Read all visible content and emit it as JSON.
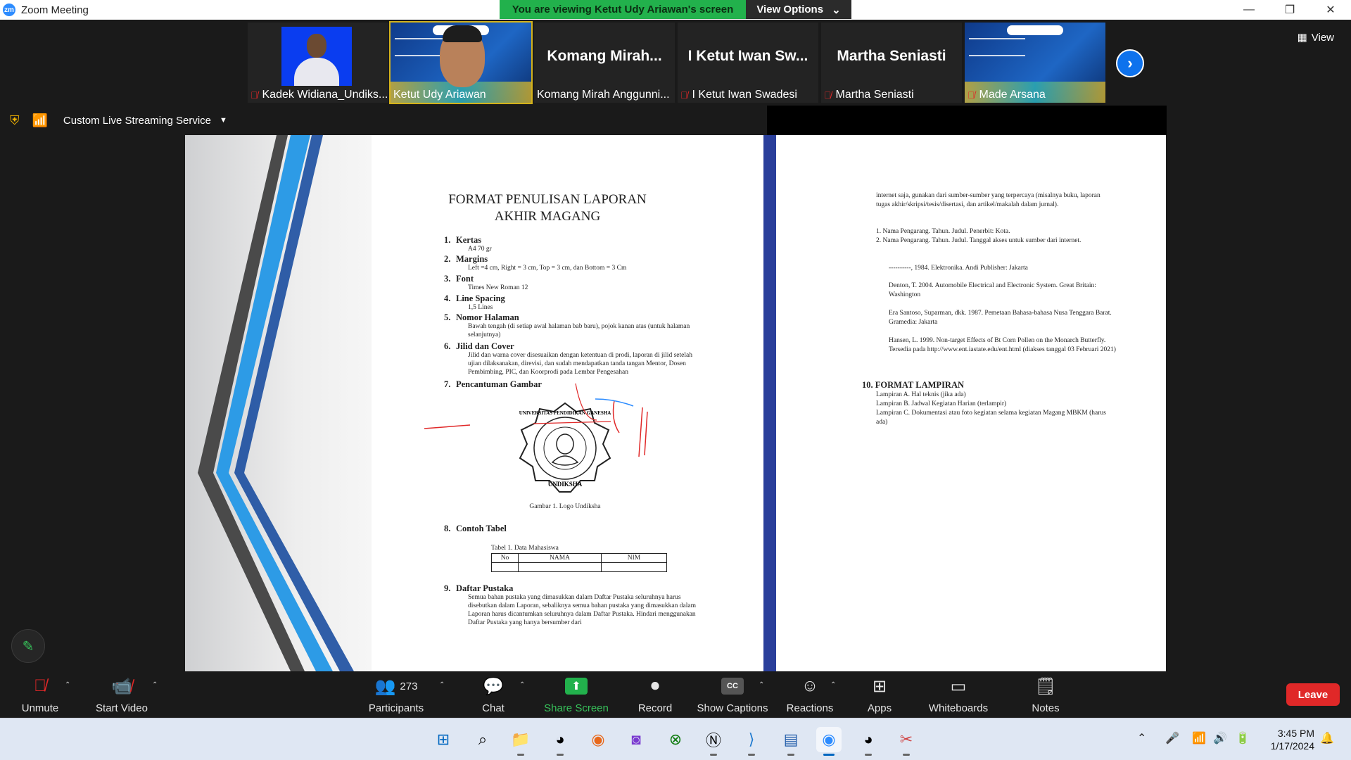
{
  "window": {
    "app_icon_text": "zm",
    "title": "Zoom Meeting",
    "minimize": "—",
    "restore": "❐",
    "close": "✕"
  },
  "banner": {
    "message": "You are viewing Ketut Udy Ariawan's screen",
    "view_options": "View Options",
    "chevron": "⌄"
  },
  "gallery": {
    "view_label": "View",
    "next": "›",
    "tiles": [
      {
        "name": "Kadek Widiana_Undiks...",
        "muted": true,
        "big_name": ""
      },
      {
        "name": "Ketut Udy Ariawan",
        "muted": false,
        "big_name": ""
      },
      {
        "name": "Komang Mirah Anggunni...",
        "muted": false,
        "big_name": "Komang  Mirah..."
      },
      {
        "name": "I Ketut Iwan Swadesi",
        "muted": true,
        "big_name": "I Ketut Iwan Sw..."
      },
      {
        "name": "Martha Seniasti",
        "muted": true,
        "big_name": "Martha Seniasti"
      },
      {
        "name": "Made Arsana",
        "muted": true,
        "big_name": ""
      }
    ]
  },
  "stream": {
    "label": "Custom Live Streaming Service",
    "caret": "▼"
  },
  "document": {
    "title_line1": "FORMAT PENULISAN LAPORAN",
    "title_line2": "AKHIR MAGANG",
    "sections": [
      {
        "num": "1.",
        "title": "Kertas",
        "body": "A4 70 gr"
      },
      {
        "num": "2.",
        "title": "Margins",
        "body": "Left =4 cm, Right = 3 cm, Top = 3 cm, dan Bottom = 3 Cm"
      },
      {
        "num": "3.",
        "title": "Font",
        "body": "Times New Roman 12"
      },
      {
        "num": "4.",
        "title": "Line Spacing",
        "body": "1,5 Lines"
      },
      {
        "num": "5.",
        "title": "Nomor Halaman",
        "body": "Bawah tengah (di setiap awal halaman bab baru), pojok kanan atas (untuk halaman selanjutnya)"
      },
      {
        "num": "6.",
        "title": "Jilid dan Cover",
        "body": "Jilid dan warna cover disesuaikan dengan ketentuan di prodi, laporan di jilid setelah ujian dilaksanakan, direvisi, dan sudah mendapatkan tanda tangan Mentor, Dosen Pembimbing, PIC, dan Koorprodi pada Lembar Pengesahan"
      },
      {
        "num": "7.",
        "title": "Pencantuman Gambar",
        "body": ""
      },
      {
        "num": "8.",
        "title": "Contoh Tabel",
        "body": ""
      },
      {
        "num": "9.",
        "title": "Daftar Pustaka",
        "body": "Semua bahan pustaka yang dimasukkan dalam Daftar Pustaka seluruhnya harus disebutkan dalam Laporan, sebaliknya semua bahan pustaka yang dimasukkan dalam Laporan harus dicantumkan seluruhnya dalam Daftar Pustaka. Hindari menggunakan Daftar Pustaka yang hanya bersumber dari"
      }
    ],
    "logo_text_top": "UNIVERSITAS PENDIDIKAN GANESHA",
    "logo_text_bottom": "UNDIKSHA",
    "figure_caption": "Gambar 1. Logo Undiksha",
    "table_caption": "Tabel 1. Data Mahasiswa",
    "table_headers": [
      "No",
      "NAMA",
      "NIM"
    ],
    "page2_intro": "internet saja, gunakan dari sumber-sumber yang terpercaya (misalnya buku, laporan tugas akhir/skripsi/tesis/disertasi, dan artikel/makalah dalam jurnal).",
    "page2_list": [
      "1.   Nama Pengarang. Tahun. Judul. Penerbit: Kota.",
      "2.   Nama Pengarang. Tahun. Judul. Tanggal akses untuk sumber dari internet."
    ],
    "refs": [
      "----------, 1984. Elektronika. Andi Publisher: Jakarta",
      "Denton, T. 2004. Automobile Electrical and Electronic System. Great Britain: Washington",
      "Era Santoso, Suparman, dkk. 1987. Pemetaan Bahasa-bahasa Nusa Tenggara Barat. Gramedia: Jakarta",
      "Hansen, L. 1999. Non-target Effects of Bt Corn Pollen on the Monarch Butterfly. Tersedia pada http://www.ent.iastate.edu/ent.html (diakses tanggal 03 Februari 2021)"
    ],
    "sec10_title": "10. FORMAT LAMPIRAN",
    "sec10_items": [
      "Lampiran A. Hal teknis (jika ada)",
      "Lampiran B. Jadwal Kegiatan Harian (terlampir)",
      "Lampiran C. Dokumentasi atau foto kegiatan selama kegiatan Magang MBKM (harus ada)"
    ]
  },
  "toolbar": {
    "unmute": "Unmute",
    "start_video": "Start Video",
    "participants": "Participants",
    "participants_count": "273",
    "chat": "Chat",
    "share_screen": "Share Screen",
    "record": "Record",
    "show_captions": "Show Captions",
    "reactions": "Reactions",
    "apps": "Apps",
    "whiteboards": "Whiteboards",
    "notes": "Notes",
    "leave": "Leave",
    "caret": "⌃",
    "cc": "CC"
  },
  "taskbar": {
    "time": "3:45 PM",
    "date": "1/17/2024"
  },
  "colors": {
    "zoom_blue": "#0e72ed",
    "share_green": "#22b14c",
    "leave_red": "#e02828",
    "doc_blue": "#2a3f9b"
  }
}
